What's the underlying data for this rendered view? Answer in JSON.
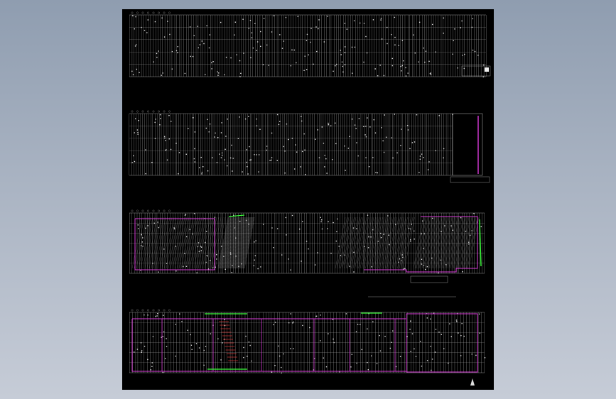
{
  "app": {
    "background_top": "#8f9db0",
    "background_bottom": "#c6ccd7",
    "viewport_color": "#000000"
  },
  "drawing": {
    "line_color": "#b9b9b9",
    "wall_color": "#d93bd9",
    "accent_color": "#3cff3c",
    "sheets": [
      {
        "id": "sheet-1",
        "kind": "column-grid"
      },
      {
        "id": "sheet-2",
        "kind": "column-grid"
      },
      {
        "id": "sheet-3",
        "kind": "partial-floor-plan"
      },
      {
        "id": "sheet-4",
        "kind": "full-floor-plan"
      }
    ]
  }
}
